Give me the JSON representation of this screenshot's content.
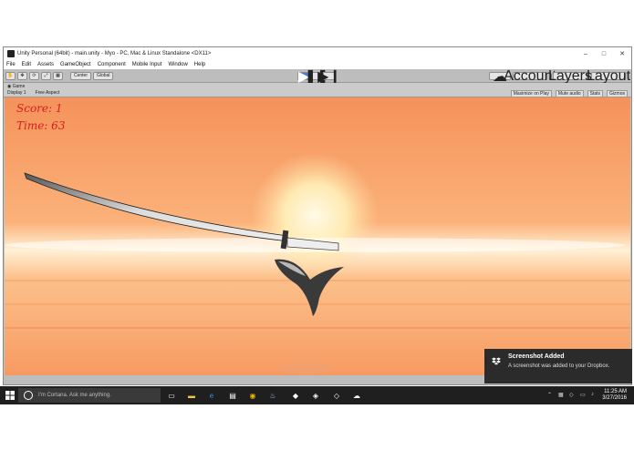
{
  "window": {
    "title": "Unity Personal (64bit) - main.unity - Myo - PC, Mac & Linux Standalone <DX11>",
    "controls": {
      "minimize": "–",
      "maximize": "□",
      "close": "✕"
    }
  },
  "menu": [
    "File",
    "Edit",
    "Assets",
    "GameObject",
    "Component",
    "Mobile Input",
    "Window",
    "Help"
  ],
  "toolbar": {
    "pivot": "Center",
    "space": "Global",
    "account": "Account",
    "layers": "Layers",
    "layout": "Layout"
  },
  "game_view": {
    "tab": "Game",
    "display": "Display 1",
    "aspect": "Free Aspect",
    "options": [
      "Maximize on Play",
      "Mute audio",
      "Stats",
      "Gizmos"
    ]
  },
  "hud": {
    "score": "Score: 1",
    "time": "Time: 63"
  },
  "toast": {
    "title": "Screenshot Added",
    "message": "A screenshot was added to your Dropbox.",
    "icon": "dropbox-icon"
  },
  "taskbar": {
    "search_placeholder": "I'm Cortana. Ask me anything.",
    "time": "11:25 AM",
    "date": "3/27/2016"
  },
  "colors": {
    "sky_top": "#f79a5a",
    "sky_mid": "#fbbd82",
    "sun": "#fff4c0",
    "hud_red": "#d42020",
    "taskbar": "#1f1f1f"
  }
}
